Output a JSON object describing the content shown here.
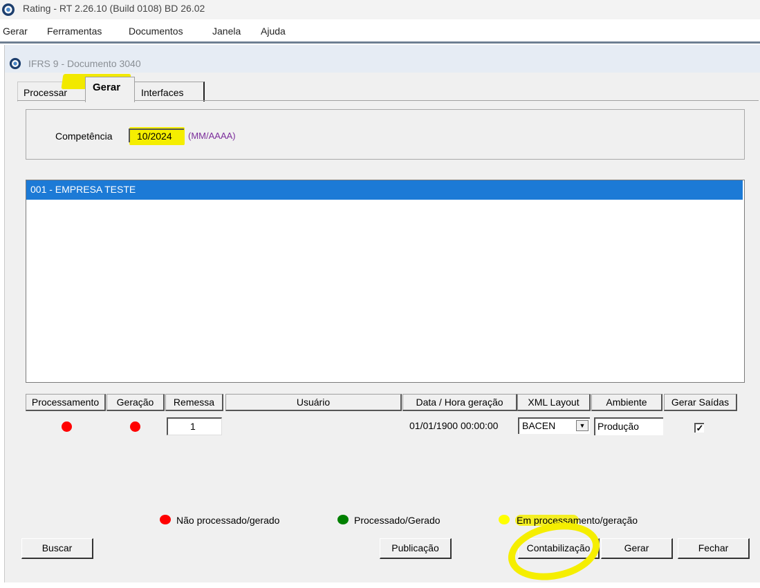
{
  "app": {
    "title": "Rating - RT 2.26.10 (Build 0108) BD 26.02"
  },
  "menu": {
    "items": [
      "Gerar",
      "Ferramentas",
      "Documentos",
      "Janela",
      "Ajuda"
    ]
  },
  "window": {
    "title": "IFRS 9 - Documento 3040"
  },
  "tabs": [
    {
      "label": "Processar",
      "active": false
    },
    {
      "label": "Gerar",
      "active": true
    },
    {
      "label": "Interfaces",
      "active": false
    }
  ],
  "competencia": {
    "label": "Competência",
    "value": "10/2024",
    "hint": "(MM/AAAA)"
  },
  "company_list": {
    "items": [
      "001 - EMPRESA TESTE"
    ],
    "selected_index": 0
  },
  "grid": {
    "headers": [
      "Processamento",
      "Geração",
      "Remessa",
      "Usuário",
      "Data / Hora geração",
      "XML Layout",
      "Ambiente",
      "Gerar Saídas"
    ],
    "row": {
      "processamento_status": "red",
      "geracao_status": "red",
      "remessa": "1",
      "usuario": "",
      "data_hora": "01/01/1900 00:00:00",
      "xml_layout": "BACEN",
      "ambiente": "Produção",
      "gerar_saidas": true,
      "gerar_saidas_mark": "✓"
    }
  },
  "legend": [
    {
      "color": "#ff0000",
      "label": "Não processado/gerado"
    },
    {
      "color": "#008000",
      "label": "Processado/Gerado"
    },
    {
      "color": "#ffff00",
      "label": "Em processamento/geração"
    }
  ],
  "buttons": {
    "buscar": "Buscar",
    "publicacao": "Publicação",
    "contabilizacao": "Contabilização",
    "gerar": "Gerar",
    "fechar": "Fechar"
  },
  "colors": {
    "selection": "#1c7ad6",
    "highlight": "#f5ee00",
    "hint": "#7b2d9b",
    "status_red": "#ff0000"
  }
}
